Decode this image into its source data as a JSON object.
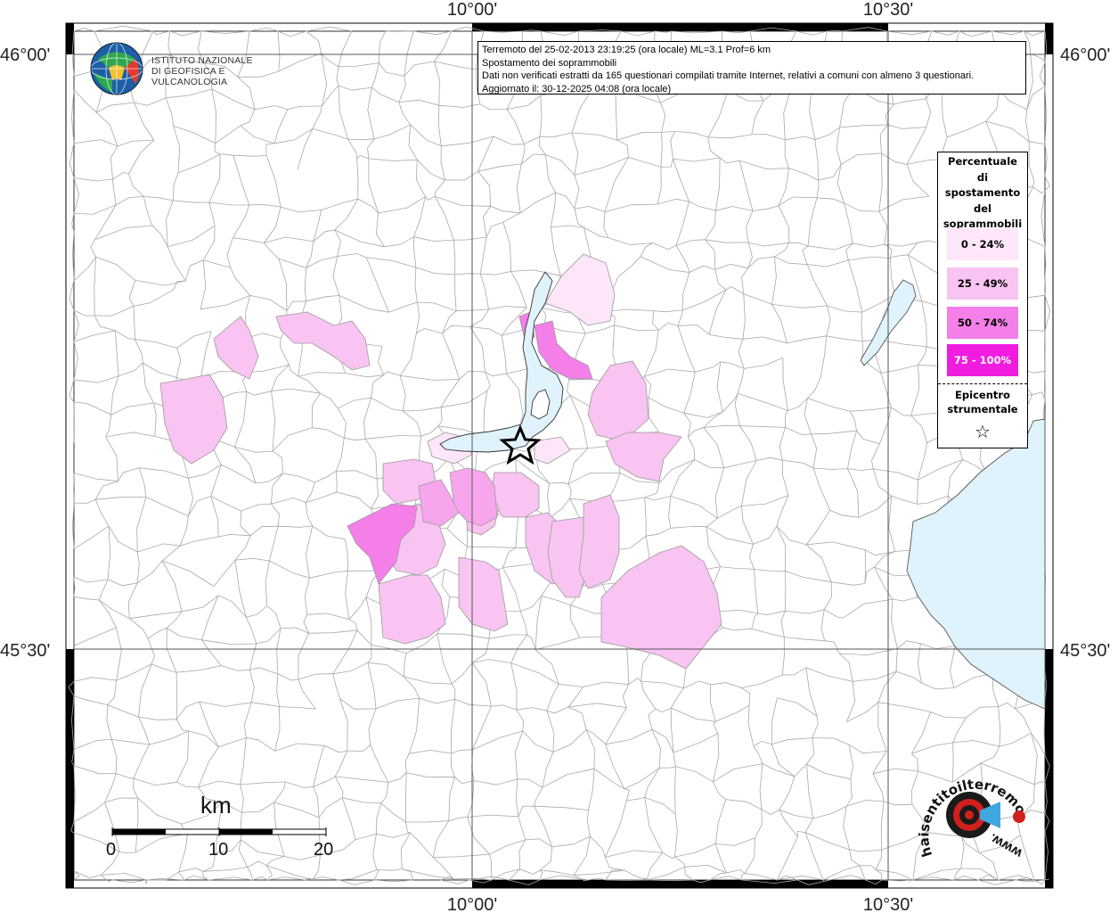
{
  "header": {
    "line1": "Terremoto del 25-02-2013 23:19:25 (ora locale) ML=3.1 Prof=6 km",
    "line2": "Spostamento dei soprammobili",
    "line3": "Dati non verificati estratti da 165 questionari compilati tramite Internet, relativi a comuni con almeno 3 questionari.",
    "line4": "Aggiornato il: 30-12-2025 04:08 (ora locale)"
  },
  "coords": {
    "top_left": "10°00'",
    "top_right": "10°30'",
    "bottom_left": "10°00'",
    "bottom_right": "10°30'",
    "left_top": "46°00'",
    "left_bottom": "45°30'",
    "right_top": "46°00'",
    "right_bottom": "45°30'"
  },
  "logo": {
    "line1": "ISTITUTO NAZIONALE",
    "line2": "DI GEOFISICA E VULCANOLOGIA"
  },
  "legend": {
    "title_lines": [
      "Percentuale",
      "di",
      "spostamento",
      "del",
      "soprammobili"
    ],
    "items": [
      {
        "label": "0 - 24%",
        "color": "#fde6f9",
        "text_color": "#000000"
      },
      {
        "label": "25 - 49%",
        "color": "#f9c4f1",
        "text_color": "#000000"
      },
      {
        "label": "50 - 74%",
        "color": "#f47fe8",
        "text_color": "#000000"
      },
      {
        "label": "75 - 100%",
        "color": "#f01de0",
        "text_color": "#ffffff"
      }
    ],
    "epicenter_line1": "Epicentro",
    "epicenter_line2": "strumentale",
    "epicenter_symbol": "☆"
  },
  "scale": {
    "unit": "km",
    "ticks": [
      "0",
      "10",
      "20"
    ]
  },
  "watermark": {
    "text": "haisentitoilterremoto.it",
    "url_text": "WWW.",
    "icon": "speaker-target-icon"
  },
  "colors": {
    "water": "#e0f2fb",
    "border": "#a8a8a8",
    "grid": "#555555"
  }
}
